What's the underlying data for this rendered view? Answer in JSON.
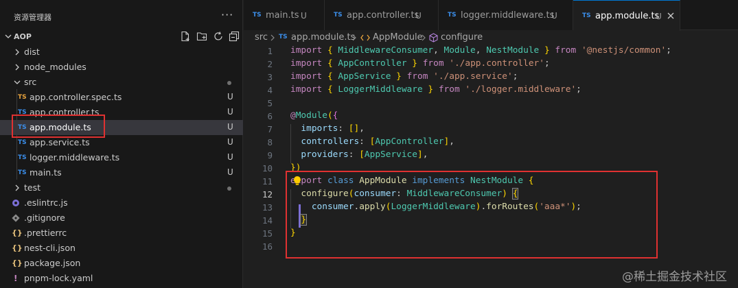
{
  "sidebar": {
    "title": "资源管理器",
    "more": "···",
    "root": "AOP",
    "items": [
      {
        "name": "dist",
        "type": "folder"
      },
      {
        "name": "node_modules",
        "type": "folder"
      },
      {
        "name": "src",
        "type": "folder-open"
      },
      {
        "name": "app.controller.spec.ts",
        "icon": "TS",
        "status": "U"
      },
      {
        "name": "app.controller.ts",
        "icon": "TS",
        "status": "U"
      },
      {
        "name": "app.module.ts",
        "icon": "TS",
        "status": "U"
      },
      {
        "name": "app.service.ts",
        "icon": "TS",
        "status": "U"
      },
      {
        "name": "logger.middleware.ts",
        "icon": "TS",
        "status": "U"
      },
      {
        "name": "main.ts",
        "icon": "TS",
        "status": "U"
      },
      {
        "name": "test",
        "type": "folder"
      },
      {
        "name": ".eslintrc.js",
        "icon": "eslint-icon"
      },
      {
        "name": ".gitignore",
        "icon": "git-icon"
      },
      {
        "name": ".prettierrc",
        "icon": "{}"
      },
      {
        "name": "nest-cli.json",
        "icon": "{}"
      },
      {
        "name": "package.json",
        "icon": "{}"
      },
      {
        "name": "pnpm-lock.yaml",
        "icon": "!"
      }
    ]
  },
  "tabs": [
    {
      "icon": "TS",
      "label": "main.ts",
      "status": "U"
    },
    {
      "icon": "TS",
      "label": "app.controller.ts",
      "status": "U"
    },
    {
      "icon": "TS",
      "label": "logger.middleware.ts",
      "status": "U"
    },
    {
      "icon": "TS",
      "label": "app.module.ts",
      "status": "U",
      "active": true
    }
  ],
  "breadcrumb": {
    "segments": [
      "src",
      "app.module.ts",
      "AppModule",
      "configure"
    ],
    "file_icon": "TS"
  },
  "editor": {
    "line_numbers": [
      "1",
      "2",
      "3",
      "4",
      "5",
      "6",
      "7",
      "8",
      "9",
      "10",
      "11",
      "12",
      "13",
      "14",
      "15",
      "16"
    ],
    "current_line": "12",
    "lines": [
      "import { MiddlewareConsumer, Module, NestModule } from '@nestjs/common';",
      "import { AppController } from './app.controller';",
      "import { AppService } from './app.service';",
      "import { LoggerMiddleware } from './logger.middleware';",
      "",
      "@Module({",
      "  imports: [],",
      "  controllers: [AppController],",
      "  providers: [AppService],",
      "})",
      "export class AppModule implements NestModule {",
      "  configure(consumer: MiddlewareConsumer) {",
      "    consumer.apply(LoggerMiddleware).forRoutes('aaa*');",
      "  }",
      "}",
      ""
    ]
  },
  "watermark": "@稀土掘金技术社区",
  "colors": {
    "highlight_box": "#e03131",
    "ts_icon": "#3b8eea",
    "keyword": "#c586c0",
    "class": "#4ec9b0",
    "string": "#ce9178"
  }
}
